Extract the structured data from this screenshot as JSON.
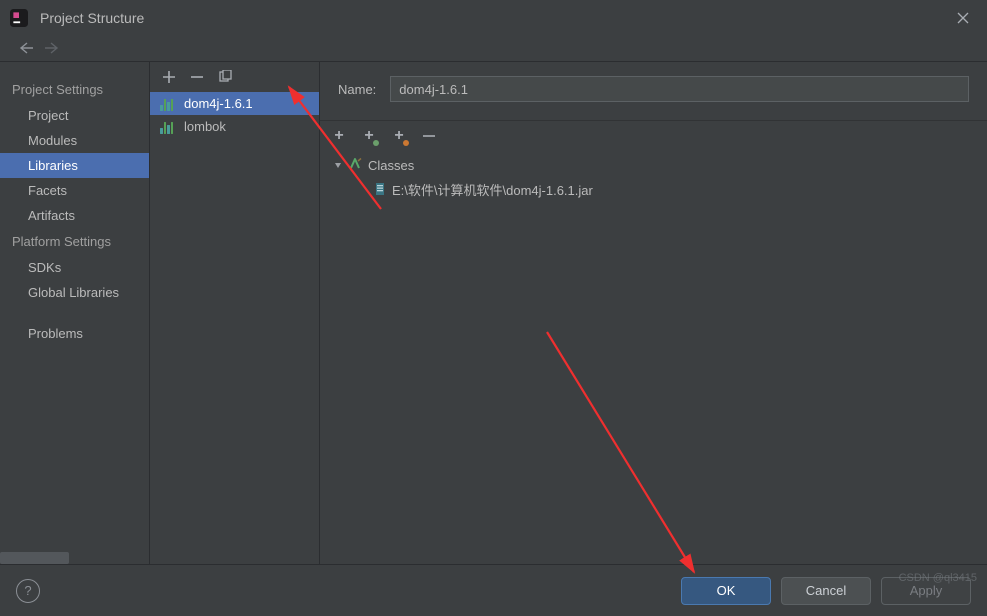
{
  "window": {
    "title": "Project Structure"
  },
  "sidebar": {
    "sections": [
      {
        "header": "Project Settings",
        "items": [
          {
            "label": "Project",
            "selected": false
          },
          {
            "label": "Modules",
            "selected": false
          },
          {
            "label": "Libraries",
            "selected": true
          },
          {
            "label": "Facets",
            "selected": false
          },
          {
            "label": "Artifacts",
            "selected": false
          }
        ]
      },
      {
        "header": "Platform Settings",
        "items": [
          {
            "label": "SDKs",
            "selected": false
          },
          {
            "label": "Global Libraries",
            "selected": false
          }
        ]
      },
      {
        "header": "",
        "items": [
          {
            "label": "Problems",
            "selected": false
          }
        ]
      }
    ]
  },
  "libraries": {
    "items": [
      {
        "label": "dom4j-1.6.1",
        "selected": true
      },
      {
        "label": "lombok",
        "selected": false
      }
    ]
  },
  "detail": {
    "name_label": "Name:",
    "name_value": "dom4j-1.6.1",
    "tree": {
      "group_label": "Classes",
      "jar_path": "E:\\软件\\计算机软件\\dom4j-1.6.1.jar"
    }
  },
  "footer": {
    "ok": "OK",
    "cancel": "Cancel",
    "apply": "Apply"
  },
  "watermark": "CSDN @ql3415",
  "colors": {
    "accent_blue": "#4b6eaf",
    "accent_red": "#ef2f2f",
    "accent_green": "#59a869",
    "accent_orange": "#cc7832",
    "lib_icon_cyan": "#499c9c",
    "lib_icon_green": "#56a156"
  }
}
